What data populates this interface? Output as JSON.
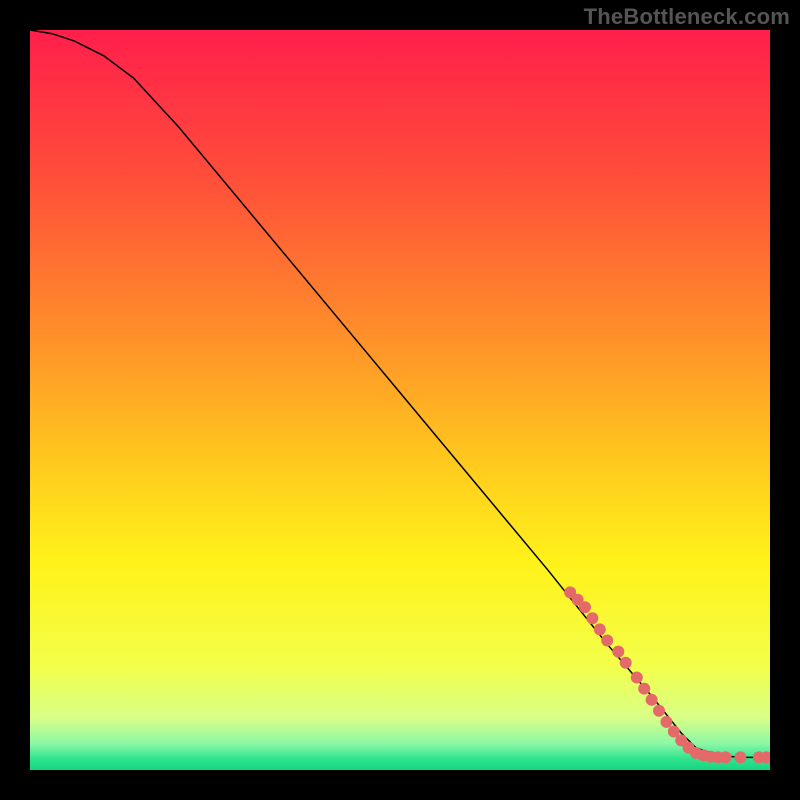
{
  "watermark": "TheBottleneck.com",
  "chart_data": {
    "type": "line",
    "title": "",
    "xlabel": "",
    "ylabel": "",
    "xlim": [
      0,
      100
    ],
    "ylim": [
      0,
      100
    ],
    "grid": false,
    "legend": false,
    "background_gradient_stops": [
      {
        "offset": 0.0,
        "color": "#ff1f4b"
      },
      {
        "offset": 0.2,
        "color": "#ff4e3a"
      },
      {
        "offset": 0.4,
        "color": "#ff8b2b"
      },
      {
        "offset": 0.58,
        "color": "#ffc81e"
      },
      {
        "offset": 0.72,
        "color": "#fff21a"
      },
      {
        "offset": 0.86,
        "color": "#f3ff4a"
      },
      {
        "offset": 0.93,
        "color": "#d8ff88"
      },
      {
        "offset": 0.965,
        "color": "#8af7a6"
      },
      {
        "offset": 0.985,
        "color": "#2fe38e"
      },
      {
        "offset": 1.0,
        "color": "#17d583"
      }
    ],
    "series": [
      {
        "name": "bottleneck-curve",
        "color": "#000000",
        "stroke_width": 1.5,
        "x": [
          0,
          3,
          6,
          10,
          14,
          20,
          30,
          40,
          50,
          60,
          70,
          78,
          84,
          88,
          90,
          93,
          96,
          100
        ],
        "y": [
          100,
          99.5,
          98.5,
          96.5,
          93.5,
          87,
          75,
          63,
          51,
          39,
          27,
          17,
          10,
          5,
          3,
          2,
          1.7,
          1.7
        ]
      }
    ],
    "marker_series": [
      {
        "name": "highlight-dots",
        "color": "#e46a6a",
        "radius": 6,
        "points": [
          {
            "x": 73,
            "y": 24
          },
          {
            "x": 74,
            "y": 23
          },
          {
            "x": 75,
            "y": 22
          },
          {
            "x": 76,
            "y": 20.5
          },
          {
            "x": 77,
            "y": 19
          },
          {
            "x": 78,
            "y": 17.5
          },
          {
            "x": 79.5,
            "y": 16
          },
          {
            "x": 80.5,
            "y": 14.5
          },
          {
            "x": 82,
            "y": 12.5
          },
          {
            "x": 83,
            "y": 11
          },
          {
            "x": 84,
            "y": 9.5
          },
          {
            "x": 85,
            "y": 8
          },
          {
            "x": 86,
            "y": 6.5
          },
          {
            "x": 87,
            "y": 5.2
          },
          {
            "x": 88,
            "y": 4
          },
          {
            "x": 89,
            "y": 3
          },
          {
            "x": 90,
            "y": 2.3
          },
          {
            "x": 91,
            "y": 2
          },
          {
            "x": 92,
            "y": 1.8
          },
          {
            "x": 93,
            "y": 1.7
          },
          {
            "x": 94,
            "y": 1.7
          },
          {
            "x": 96,
            "y": 1.7
          },
          {
            "x": 98.5,
            "y": 1.7
          },
          {
            "x": 99.5,
            "y": 1.7
          }
        ]
      }
    ]
  }
}
